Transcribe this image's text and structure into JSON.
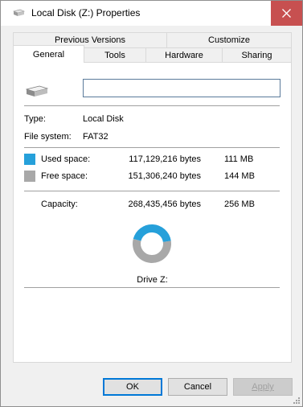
{
  "window": {
    "title": "Local Disk (Z:) Properties"
  },
  "tabs": {
    "row1": [
      "Previous Versions",
      "Customize"
    ],
    "row2": [
      "General",
      "Tools",
      "Hardware",
      "Sharing"
    ],
    "active": "General"
  },
  "general": {
    "volume_label_value": "",
    "type_label": "Type:",
    "type_value": "Local Disk",
    "fs_label": "File system:",
    "fs_value": "FAT32",
    "used_label": "Used space:",
    "used_bytes": "117,129,216 bytes",
    "used_size": "111 MB",
    "free_label": "Free space:",
    "free_bytes": "151,306,240 bytes",
    "free_size": "144 MB",
    "capacity_label": "Capacity:",
    "capacity_bytes": "268,435,456 bytes",
    "capacity_size": "256 MB",
    "drive_label": "Drive Z:",
    "used_fraction": 0.436
  },
  "colors": {
    "used": "#26a0da",
    "free": "#a8a8a8",
    "close": "#c75050"
  },
  "buttons": {
    "ok": "OK",
    "cancel": "Cancel",
    "apply": "Apply"
  },
  "icons": [
    "drive-icon",
    "close-icon",
    "resize-grip-icon"
  ]
}
